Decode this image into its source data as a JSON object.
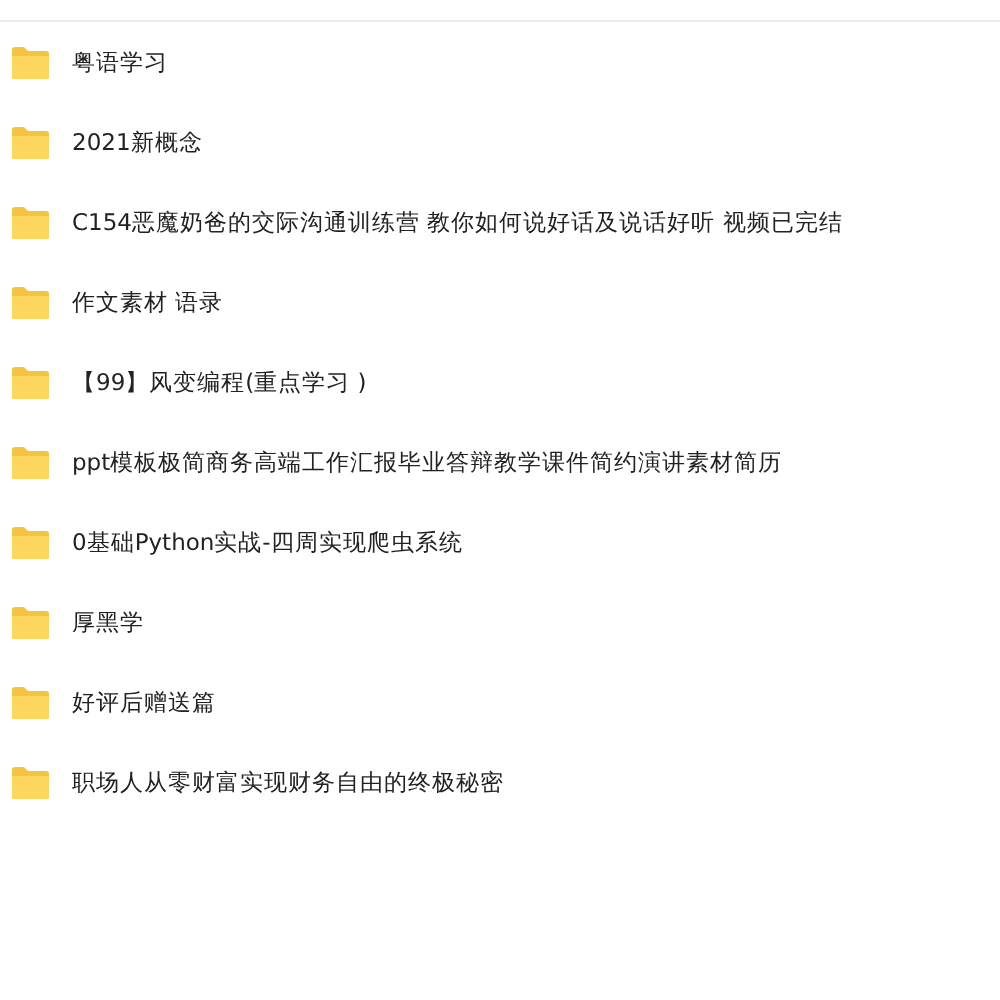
{
  "folders": [
    {
      "name": "粤语学习"
    },
    {
      "name": "2021新概念"
    },
    {
      "name": "C154恶魔奶爸的交际沟通训练营 教你如何说好话及说话好听 视频已完结"
    },
    {
      "name": "作文素材 语录"
    },
    {
      "name": "【99】风变编程(重点学习 )"
    },
    {
      "name": "ppt模板极简商务高端工作汇报毕业答辩教学课件简约演讲素材简历"
    },
    {
      "name": "0基础Python实战-四周实现爬虫系统"
    },
    {
      "name": "厚黑学"
    },
    {
      "name": "好评后赠送篇"
    },
    {
      "name": "职场人从零财富实现财务自由的终极秘密"
    }
  ]
}
